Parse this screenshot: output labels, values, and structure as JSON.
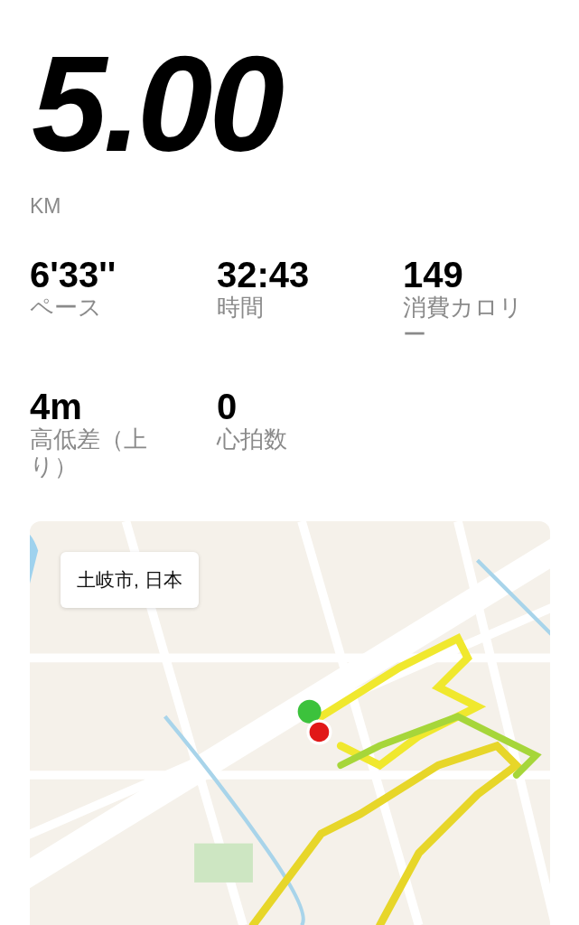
{
  "distance": {
    "value": "5.00",
    "unit": "KM"
  },
  "stats": [
    {
      "value": "6'33''",
      "label": "ペース"
    },
    {
      "value": "32:43",
      "label": "時間"
    },
    {
      "value": "149",
      "label": "消費カロリー"
    },
    {
      "value": "4m",
      "label": "高低差（上り）"
    },
    {
      "value": "0",
      "label": "心拍数"
    }
  ],
  "map": {
    "kind": "picture",
    "location_label": "土岐市, 日本"
  }
}
